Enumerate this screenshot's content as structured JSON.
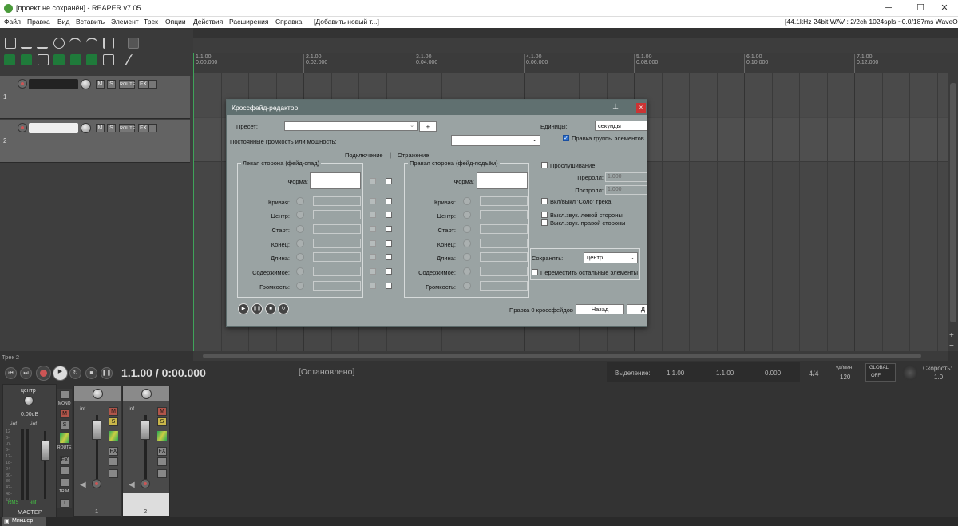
{
  "window": {
    "title": "[проект не сохранён] - REAPER v7.05",
    "minimize": "─",
    "maximize": "☐",
    "close": "✕"
  },
  "menu": {
    "items": [
      "Файл",
      "Правка",
      "Вид",
      "Вставить",
      "Элемент",
      "Трек",
      "Опции",
      "Действия",
      "Расширения",
      "Справка",
      "[Добавить новый т...]"
    ],
    "status": "[44.1kHz 24bit WAV : 2/2ch 1024spls ~0.0/187ms WaveOut]"
  },
  "ruler": {
    "marks": [
      {
        "bar": "1.1.00",
        "time": "0:00.000"
      },
      {
        "bar": "2.1.00",
        "time": "0:02.000"
      },
      {
        "bar": "3.1.00",
        "time": "0:04.000"
      },
      {
        "bar": "4.1.00",
        "time": "0:06.000"
      },
      {
        "bar": "5.1.00",
        "time": "0:08.000"
      },
      {
        "bar": "6.1.00",
        "time": "0:10.000"
      },
      {
        "bar": "7.1.00",
        "time": "0:12.000"
      }
    ]
  },
  "tracks": [
    {
      "number": "1"
    },
    {
      "number": "2"
    }
  ],
  "track_buttons": {
    "mute": "M",
    "solo": "S",
    "route": "ROUTE",
    "fx": "FX"
  },
  "track_label": "Трек 2",
  "dialog": {
    "title": "Кроссфейд-редактор",
    "preset_label": "Пресет:",
    "preset_add": "+",
    "constant_label": "Постоянные громкость или мощность:",
    "units_label": "Единицы:",
    "units_value": "секунды",
    "group_edit": "Правка группы элементов",
    "link_label": "Подключение",
    "separator": "|",
    "reflect_label": "Отражение",
    "left_group": "Левая сторона (фейд-спад)",
    "right_group": "Правая сторона (фейд-подъём)",
    "params": [
      "Форма:",
      "Кривая:",
      "Центр:",
      "Старт:",
      "Конец:",
      "Длина:",
      "Содержимое:",
      "Громкость:"
    ],
    "preview": "Прослушивание:",
    "preroll_label": "Преролл:",
    "preroll_value": "1.000",
    "postroll_label": "Постролл:",
    "postroll_value": "1.000",
    "solo_toggle": "Вкл/выкл 'Соло' трека",
    "mute_left": "Выкл.звук. левой стороны",
    "mute_right": "Выкл.звук. правой стороны",
    "keep_label": "Сохранять:",
    "keep_value": "центр",
    "move_others": "Переместить остальные элементы",
    "status": "Правка 0 кроссфейдов",
    "back_button": "Назад",
    "forward_button": "Д"
  },
  "transport": {
    "position": "1.1.00 / 0:00.000",
    "state": "[Остановлено]",
    "selection_label": "Выделение:",
    "sel_start": "1.1.00",
    "sel_end": "1.1.00",
    "sel_length": "0.000",
    "timesig": "4/4",
    "bpm_label": "уд/мин",
    "bpm": "120",
    "global_label": "GLOBAL",
    "global_state": "OFF",
    "rate_label": "Скорость:",
    "rate": "1.0"
  },
  "mixer": {
    "master": {
      "pan_label": "центр",
      "volume": "0.00dB",
      "left_peak": "-inf",
      "right_peak": "-inf",
      "scale": [
        "12",
        "6-",
        "-0-",
        "6-",
        "12-",
        "18-",
        "24-",
        "30-",
        "36-",
        "42-",
        "48-",
        "54-"
      ],
      "rms": "RMS",
      "rms_value": "-inf",
      "name": "МАСТЕР",
      "mono": "MONO",
      "route": "ROUTE",
      "trim": "TRIM"
    },
    "strips": [
      {
        "number": "1",
        "peak": "-inf"
      },
      {
        "number": "2",
        "peak": "-inf"
      }
    ],
    "tab": "Микшер"
  },
  "colors": {
    "dialog_bg": "#9aa3a3",
    "dialog_title": "#607070",
    "arrange": "#464646",
    "accent": "#2a6fd0"
  }
}
